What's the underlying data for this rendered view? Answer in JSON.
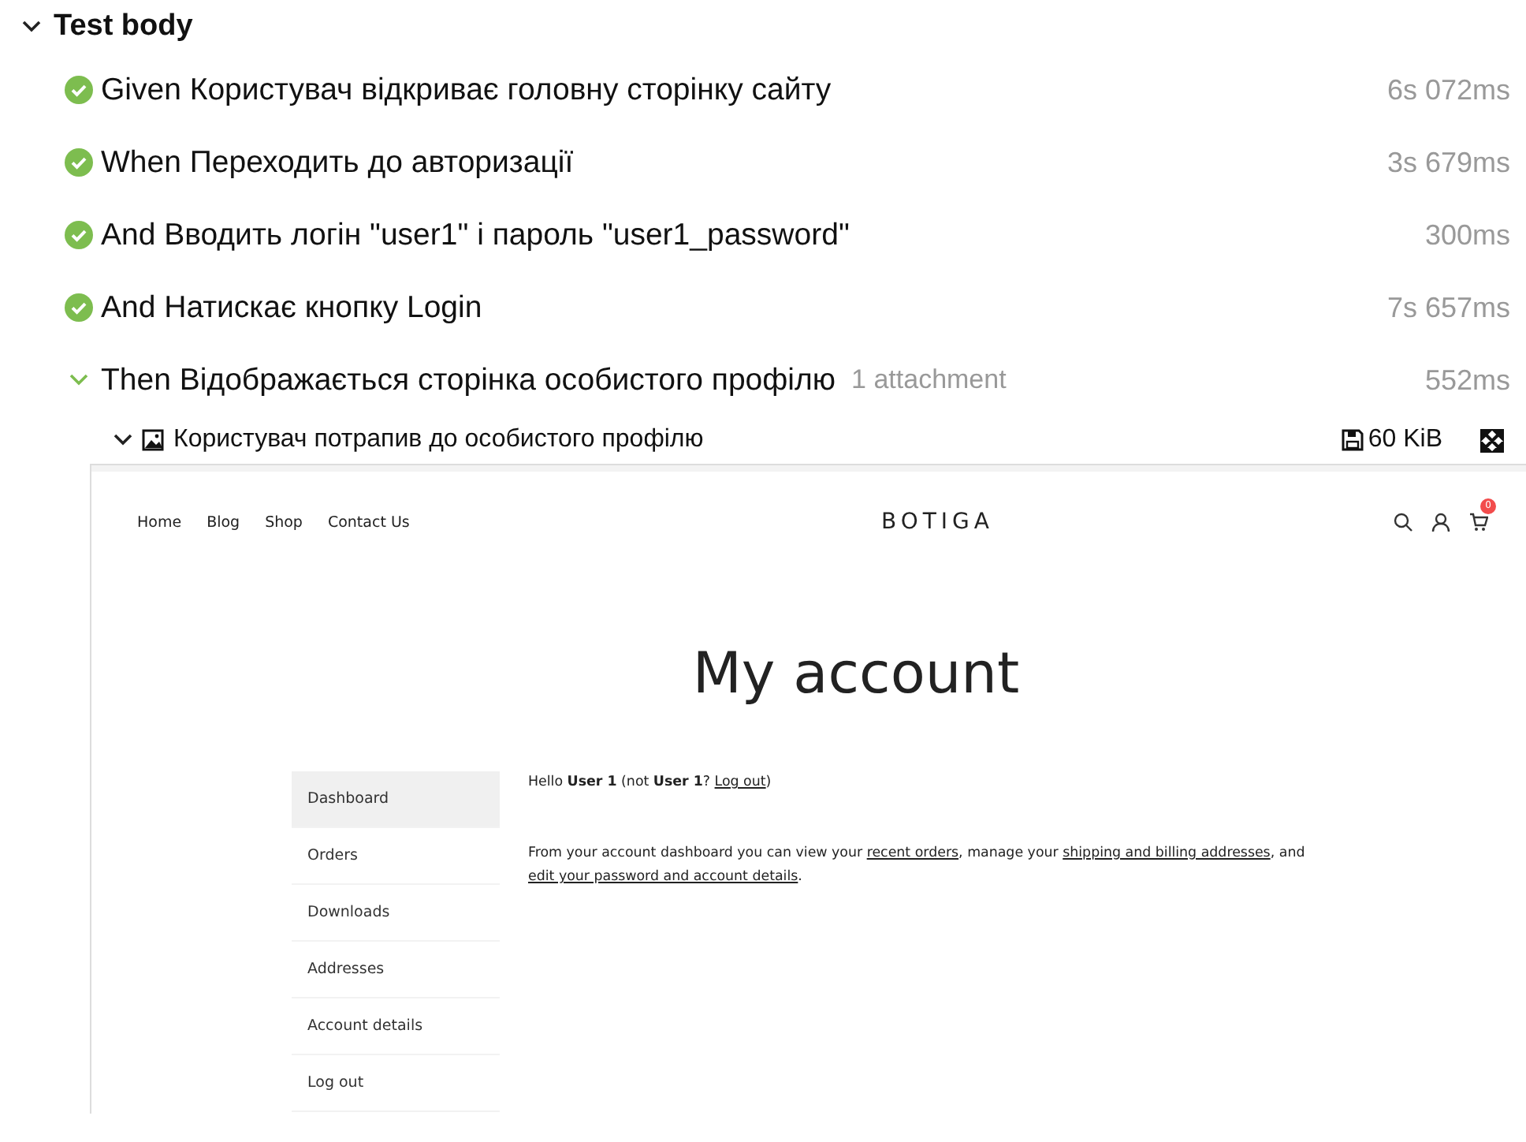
{
  "section": {
    "title": "Test body",
    "expanded": true
  },
  "steps": [
    {
      "text": "Given Користувач відкриває головну сторінку сайту",
      "duration": "6s 072ms",
      "expanded": false
    },
    {
      "text": "When Переходить до авторизації",
      "duration": "3s 679ms",
      "expanded": false
    },
    {
      "text": "And Вводить логін \"user1\" і пароль \"user1_password\"",
      "duration": "300ms",
      "expanded": false
    },
    {
      "text": "And Натискає кнопку Login",
      "duration": "7s 657ms",
      "expanded": false
    },
    {
      "text": "Then Відображається сторінка особистого профілю",
      "attachments": "1 attachment",
      "duration": "552ms",
      "expanded": true
    }
  ],
  "attachment": {
    "title": "Користувач потрапив до особистого профілю",
    "size": "60 KiB",
    "expanded": true
  },
  "site": {
    "nav": [
      "Home",
      "Blog",
      "Shop",
      "Contact Us"
    ],
    "logo": "BOTIGA",
    "cart_count": "0",
    "heading": "My account",
    "sidebar": [
      {
        "label": "Dashboard",
        "selected": true
      },
      {
        "label": "Orders",
        "selected": false
      },
      {
        "label": "Downloads",
        "selected": false
      },
      {
        "label": "Addresses",
        "selected": false
      },
      {
        "label": "Account details",
        "selected": false
      },
      {
        "label": "Log out",
        "selected": false
      }
    ],
    "greeting": [
      {
        "kind": "text",
        "text": "Hello **User 1** (not **User 1**? "
      },
      {
        "kind": "link",
        "text": "Log out"
      },
      {
        "kind": "text",
        "text": ")"
      }
    ],
    "intro": [
      {
        "kind": "text",
        "text": "From your account dashboard you can view your "
      },
      {
        "kind": "link",
        "text": "recent orders"
      },
      {
        "kind": "text",
        "text": ", manage your "
      },
      {
        "kind": "link",
        "text": "shipping and billing addresses"
      },
      {
        "kind": "text",
        "text": ", and "
      },
      {
        "kind": "link",
        "text": "edit your password and account details"
      },
      {
        "kind": "text",
        "text": "."
      }
    ]
  }
}
